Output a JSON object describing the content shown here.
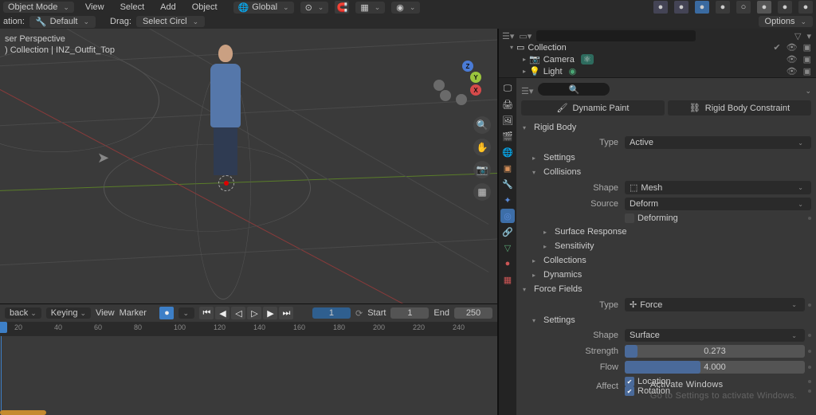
{
  "header": {
    "mode": "Object Mode",
    "menus": [
      "View",
      "Select",
      "Add",
      "Object"
    ],
    "orientation": "Global"
  },
  "subheader": {
    "ation_label": "ation:",
    "ation_value": "Default",
    "drag_label": "Drag:",
    "drag_value": "Select Circl",
    "options": "Options"
  },
  "viewport": {
    "line1": "ser Perspective",
    "line2": ") Collection | INZ_Outfit_Top"
  },
  "gizmo": {
    "x": "X",
    "y": "Y",
    "z": "Z"
  },
  "timeline": {
    "back_label": "back",
    "keying_label": "Keying",
    "view_label": "View",
    "marker_label": "Marker",
    "frame": "1",
    "start_label": "Start",
    "start": "1",
    "end_label": "End",
    "end": "250",
    "ticks": [
      "20",
      "40",
      "60",
      "80",
      "100",
      "120",
      "140",
      "160",
      "180",
      "200",
      "220",
      "240"
    ]
  },
  "outliner": {
    "collection": "Collection",
    "camera": "Camera",
    "light": "Light"
  },
  "properties": {
    "tabs": {
      "dynamic_paint": "Dynamic Paint",
      "rigid_body_constraint": "Rigid Body Constraint"
    },
    "sections": {
      "rigid_body": "Rigid Body",
      "settings": "Settings",
      "collisions": "Collisions",
      "surface_response": "Surface Response",
      "sensitivity": "Sensitivity",
      "collections": "Collections",
      "dynamics": "Dynamics",
      "force_fields": "Force Fields"
    },
    "rigid_body": {
      "type_label": "Type",
      "type_value": "Active",
      "shape_label": "Shape",
      "shape_value": "Mesh",
      "source_label": "Source",
      "source_value": "Deform",
      "deforming_label": "Deforming"
    },
    "force_fields": {
      "type_label": "Type",
      "type_value": "Force",
      "shape_label": "Shape",
      "shape_value": "Surface",
      "strength_label": "Strength",
      "strength_value": "0.273",
      "flow_label": "Flow",
      "flow_value": "4.000",
      "affect_label": "Affect",
      "location": "Location",
      "rotation": "Rotation"
    }
  },
  "watermark": {
    "title": "Activate Windows",
    "sub": "Go to Settings to activate Windows."
  }
}
